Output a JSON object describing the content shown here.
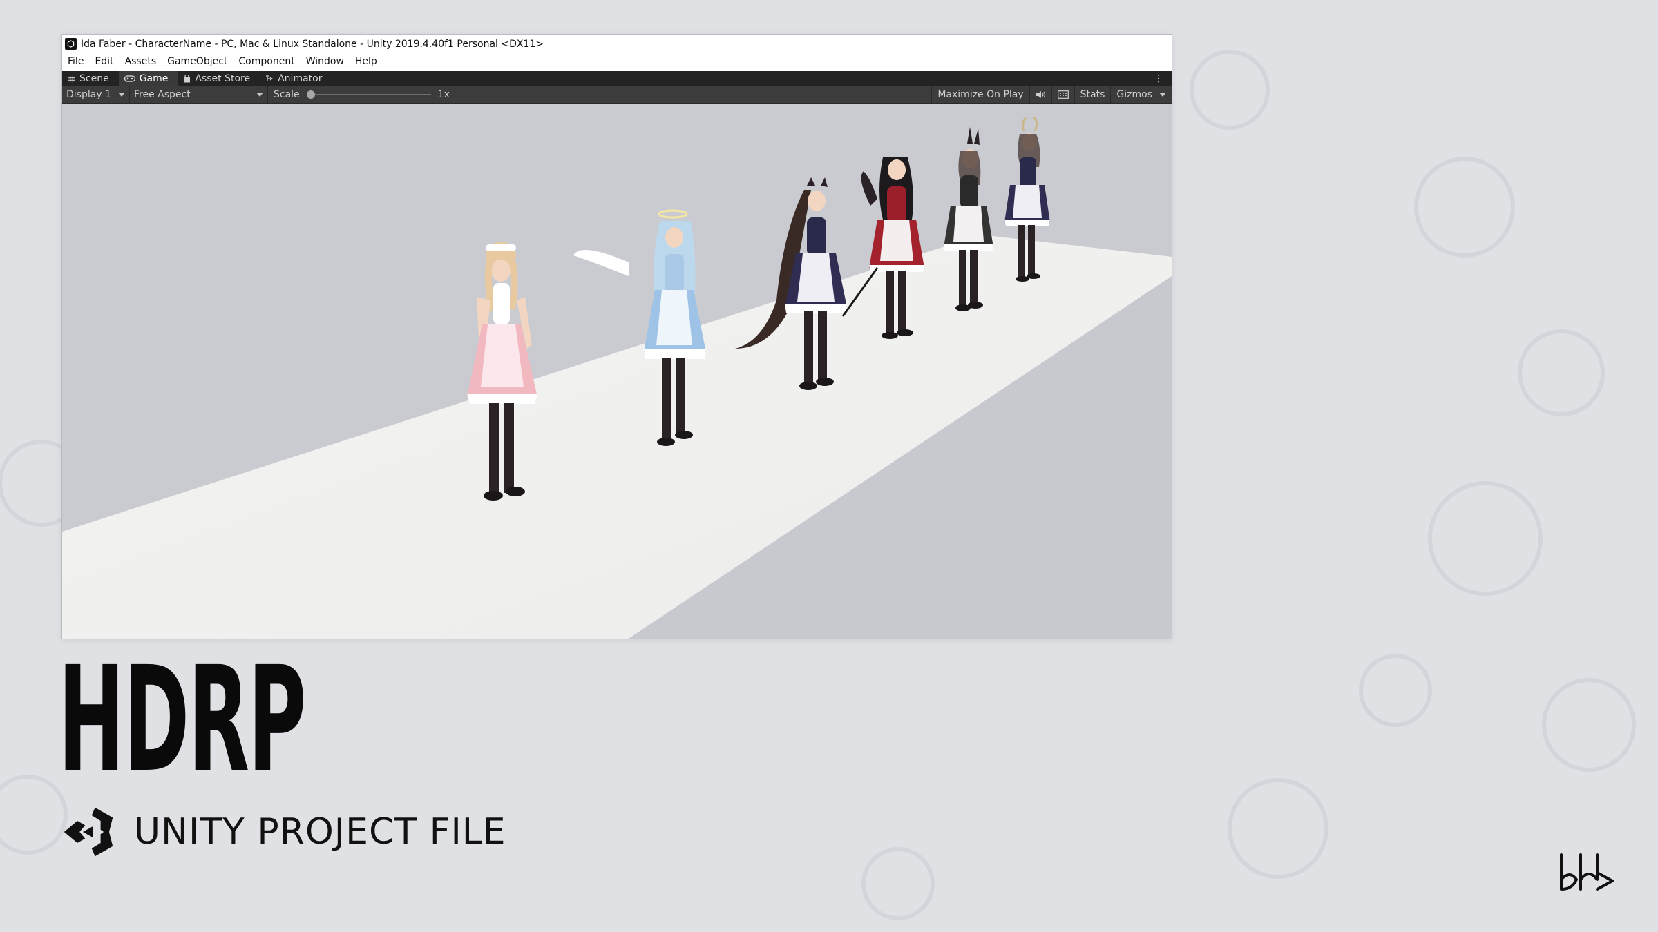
{
  "window": {
    "title": "Ida Faber - CharacterName - PC, Mac & Linux Standalone - Unity 2019.4.40f1 Personal <DX11>"
  },
  "menu": [
    "File",
    "Edit",
    "Assets",
    "GameObject",
    "Component",
    "Window",
    "Help"
  ],
  "tabs": [
    {
      "label": "Scene",
      "icon": "grid-icon"
    },
    {
      "label": "Game",
      "icon": "gamepad-icon"
    },
    {
      "label": "Asset Store",
      "icon": "bag-icon"
    },
    {
      "label": "Animator",
      "icon": "animator-icon"
    }
  ],
  "toolbar": {
    "display": "Display 1",
    "aspect": "Free Aspect",
    "scale_label": "Scale",
    "scale_value": "1x",
    "scale_fraction": 0.0,
    "maximize": "Maximize On Play",
    "stats": "Stats",
    "gizmos": "Gizmos"
  },
  "headline": "HDRP",
  "subtitle": "UNITY PROJECT FILE",
  "colors": {
    "dark_bar": "#232323",
    "toolbar": "#3c3c3c",
    "viewport_bg": "#c8cacf",
    "floor": "#f2f2f0",
    "page_bg": "#dfe1e5"
  }
}
